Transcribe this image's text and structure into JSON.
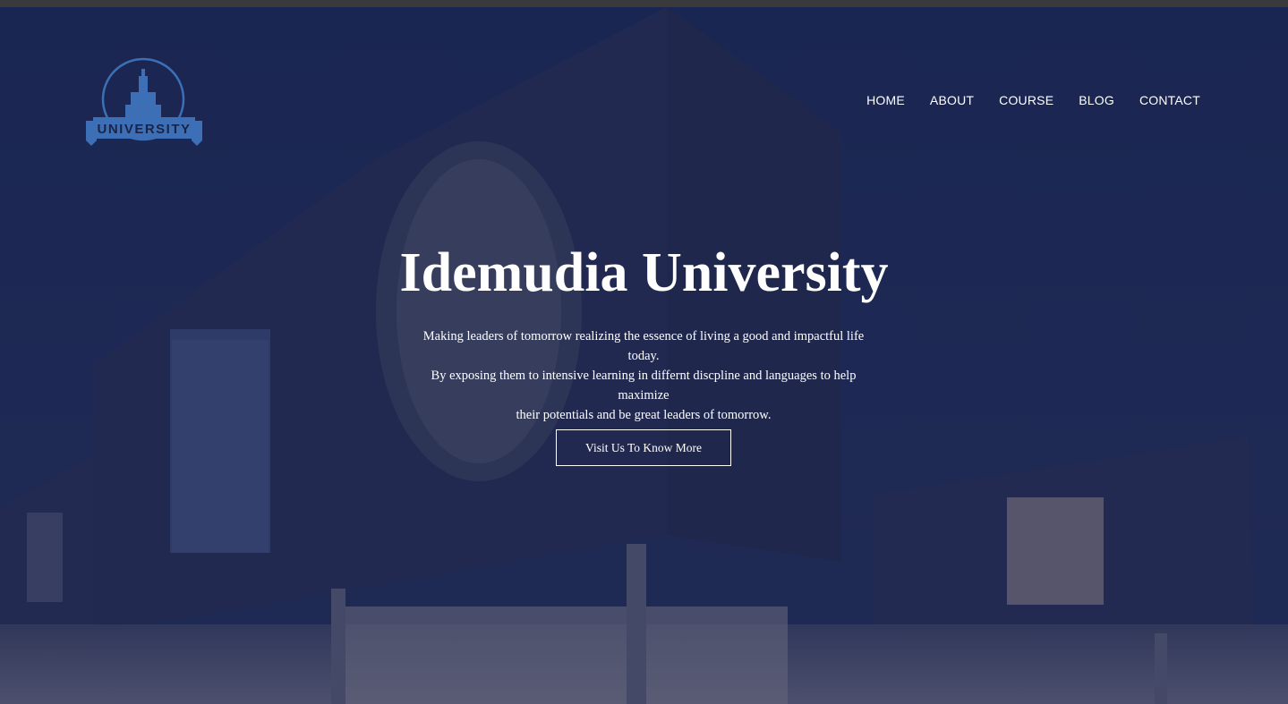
{
  "logo": {
    "text": "UNIVERSITY",
    "color": "#3d6fb6"
  },
  "nav": {
    "items": [
      {
        "label": "HOME"
      },
      {
        "label": "ABOUT"
      },
      {
        "label": "COURSE"
      },
      {
        "label": "BLOG"
      },
      {
        "label": "CONTACT"
      }
    ]
  },
  "hero": {
    "title": "Idemudia University",
    "subtitle_lines": [
      "Making leaders of tomorrow realizing the essence of living a good and impactful life today.",
      "By exposing them to intensive learning in differnt discpline and languages to help maximize",
      "their potentials and be great leaders of tomorrow."
    ],
    "cta_label": "Visit Us To Know More"
  },
  "colors": {
    "overlay": "#1b2447",
    "text": "#ffffff"
  }
}
